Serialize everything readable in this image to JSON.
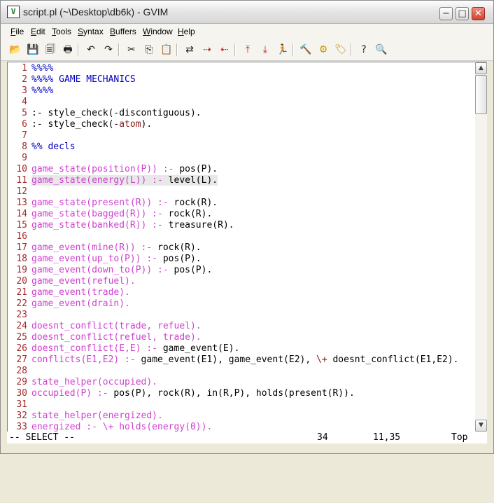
{
  "window": {
    "title": "script.pl (~\\Desktop\\db6k) - GVIM",
    "app_icon": "gvim-icon",
    "controls": {
      "minimize": "−",
      "maximize": "□",
      "close": "✕"
    }
  },
  "menu": {
    "items": [
      {
        "label": "File",
        "key": "F",
        "rest": "ile"
      },
      {
        "label": "Edit",
        "key": "E",
        "rest": "dit"
      },
      {
        "label": "Tools",
        "key": "T",
        "rest": "ools"
      },
      {
        "label": "Syntax",
        "key": "S",
        "rest": "yntax"
      },
      {
        "label": "Buffers",
        "key": "B",
        "rest": "uffers"
      },
      {
        "label": "Window",
        "key": "W",
        "rest": "indow"
      },
      {
        "label": "Help",
        "key": "H",
        "rest": "elp"
      }
    ]
  },
  "toolbar": {
    "icons": [
      {
        "name": "open-icon",
        "glyph": "📂"
      },
      {
        "name": "save-icon",
        "glyph": "💾"
      },
      {
        "name": "save-all-icon",
        "glyph": "🗐"
      },
      {
        "name": "print-icon",
        "glyph": "🖶"
      },
      {
        "name": "undo-icon",
        "glyph": "↶"
      },
      {
        "name": "redo-icon",
        "glyph": "↷"
      },
      {
        "name": "cut-icon",
        "glyph": "✂"
      },
      {
        "name": "copy-icon",
        "glyph": "⎘"
      },
      {
        "name": "paste-icon",
        "glyph": "📋"
      },
      {
        "name": "replace-icon",
        "glyph": "⇄"
      },
      {
        "name": "find-next-icon",
        "glyph": "⇢"
      },
      {
        "name": "find-prev-icon",
        "glyph": "⇠"
      },
      {
        "name": "load-session-icon",
        "glyph": "⤒"
      },
      {
        "name": "save-session-icon",
        "glyph": "⤓"
      },
      {
        "name": "run-script-icon",
        "glyph": "🏃"
      },
      {
        "name": "make-icon",
        "glyph": "🔨"
      },
      {
        "name": "shell-icon",
        "glyph": "⚙"
      },
      {
        "name": "tags-icon",
        "glyph": "🏷"
      },
      {
        "name": "help-icon",
        "glyph": "?"
      },
      {
        "name": "find-help-icon",
        "glyph": "🔍"
      }
    ]
  },
  "editor": {
    "lines": [
      {
        "n": "1",
        "segs": [
          {
            "t": "%%%%",
            "c": "comment"
          }
        ]
      },
      {
        "n": "2",
        "segs": [
          {
            "t": "%%%% GAME MECHANICS",
            "c": "comment"
          }
        ]
      },
      {
        "n": "3",
        "segs": [
          {
            "t": "%%%%",
            "c": "comment"
          }
        ]
      },
      {
        "n": "4",
        "segs": []
      },
      {
        "n": "5",
        "segs": [
          {
            "t": ":- style_check(-discontiguous).",
            "c": "norm"
          }
        ]
      },
      {
        "n": "6",
        "segs": [
          {
            "t": ":- style_check(-",
            "c": "norm"
          },
          {
            "t": "atom",
            "c": "maroon"
          },
          {
            "t": ").",
            "c": "norm"
          }
        ]
      },
      {
        "n": "7",
        "segs": []
      },
      {
        "n": "8",
        "segs": [
          {
            "t": "%% decls",
            "c": "comment"
          }
        ]
      },
      {
        "n": "9",
        "segs": []
      },
      {
        "n": "10",
        "segs": [
          {
            "t": "game_state(position(P)) :- ",
            "c": "pred"
          },
          {
            "t": "pos(P).",
            "c": "norm"
          }
        ]
      },
      {
        "n": "11",
        "segs": [
          {
            "t": "game_state(energy(L)) :- ",
            "c": "pred"
          },
          {
            "t": "level(L).",
            "c": "norm"
          }
        ],
        "hl": true
      },
      {
        "n": "12",
        "segs": []
      },
      {
        "n": "13",
        "segs": [
          {
            "t": "game_state(present(R)) :- ",
            "c": "pred"
          },
          {
            "t": "rock(R).",
            "c": "norm"
          }
        ]
      },
      {
        "n": "14",
        "segs": [
          {
            "t": "game_state(bagged(R)) :- ",
            "c": "pred"
          },
          {
            "t": "rock(R).",
            "c": "norm"
          }
        ]
      },
      {
        "n": "15",
        "segs": [
          {
            "t": "game_state(banked(R)) :- ",
            "c": "pred"
          },
          {
            "t": "treasure(R).",
            "c": "norm"
          }
        ]
      },
      {
        "n": "16",
        "segs": []
      },
      {
        "n": "17",
        "segs": [
          {
            "t": "game_event(mine(R)) :- ",
            "c": "pred"
          },
          {
            "t": "rock(R).",
            "c": "norm"
          }
        ]
      },
      {
        "n": "18",
        "segs": [
          {
            "t": "game_event(up_to(P)) :- ",
            "c": "pred"
          },
          {
            "t": "pos(P).",
            "c": "norm"
          }
        ]
      },
      {
        "n": "19",
        "segs": [
          {
            "t": "game_event(down_to(P)) :- ",
            "c": "pred"
          },
          {
            "t": "pos(P).",
            "c": "norm"
          }
        ]
      },
      {
        "n": "20",
        "segs": [
          {
            "t": "game_event(refuel).",
            "c": "pred"
          }
        ]
      },
      {
        "n": "21",
        "segs": [
          {
            "t": "game_event(trade).",
            "c": "pred"
          }
        ]
      },
      {
        "n": "22",
        "segs": [
          {
            "t": "game_event(drain).",
            "c": "pred"
          }
        ]
      },
      {
        "n": "23",
        "segs": []
      },
      {
        "n": "24",
        "segs": [
          {
            "t": "doesnt_conflict(trade, refuel).",
            "c": "pred"
          }
        ]
      },
      {
        "n": "25",
        "segs": [
          {
            "t": "doesnt_conflict(refuel, trade).",
            "c": "pred"
          }
        ]
      },
      {
        "n": "26",
        "segs": [
          {
            "t": "doesnt_conflict(E,E) :- ",
            "c": "pred"
          },
          {
            "t": "game_event(E).",
            "c": "norm"
          }
        ]
      },
      {
        "n": "27",
        "segs": [
          {
            "t": "conflicts(E1,E2) :- ",
            "c": "pred"
          },
          {
            "t": "game_event(E1), game_event(E2), ",
            "c": "norm"
          },
          {
            "t": "\\+",
            "c": "maroon"
          },
          {
            "t": " doesnt_conflict(E1,E2).",
            "c": "norm"
          }
        ]
      },
      {
        "n": "28",
        "segs": []
      },
      {
        "n": "29",
        "segs": [
          {
            "t": "state_helper(occupied).",
            "c": "pred"
          }
        ]
      },
      {
        "n": "30",
        "segs": [
          {
            "t": "occupied(P) :- ",
            "c": "pred"
          },
          {
            "t": "pos(P), rock(R), in(R,P), holds(present(R)).",
            "c": "norm"
          }
        ]
      },
      {
        "n": "31",
        "segs": []
      },
      {
        "n": "32",
        "segs": [
          {
            "t": "state_helper(energized).",
            "c": "pred"
          }
        ]
      },
      {
        "n": "33",
        "segs": [
          {
            "t": "energized :- \\+ holds(energy(0)).",
            "c": "pred"
          }
        ]
      }
    ],
    "colors": {
      "comment": "#0000c0",
      "pred": "#d040d0",
      "norm": "#000000",
      "maroon": "#8b1a1a",
      "line_number": "#a52a2a"
    }
  },
  "status": {
    "mode": "-- SELECT --",
    "selected_lines": "34",
    "cursor": "11,35",
    "position": "Top"
  }
}
